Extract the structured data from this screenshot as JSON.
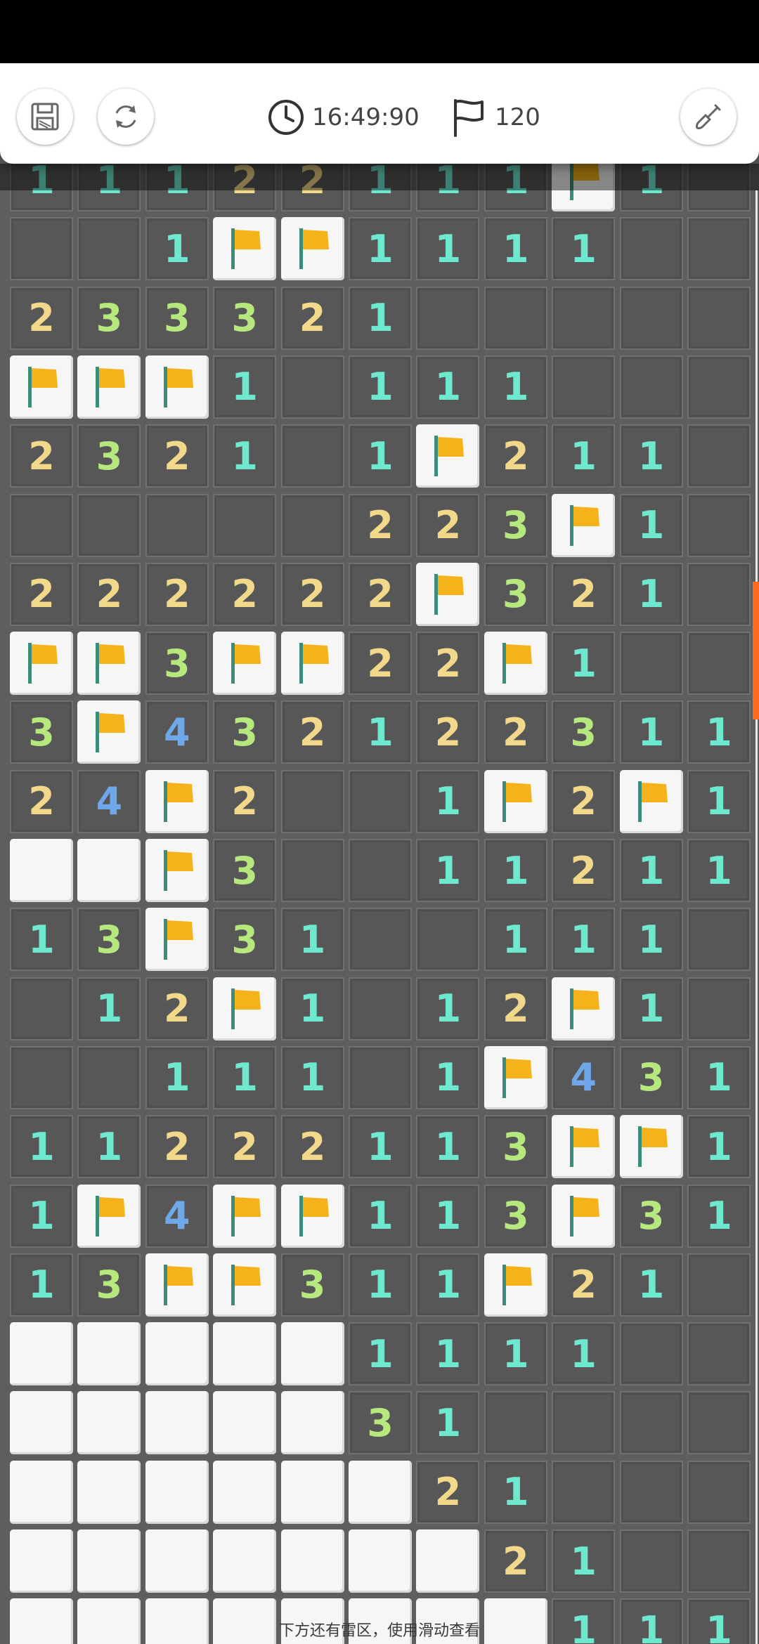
{
  "header": {
    "timer": "16:49:90",
    "flag_count": "120"
  },
  "board": {
    "columns": 11,
    "rows": [
      "11122111F1HH",
      "HH1FF1111HH",
      "233321HHHHH",
      "FFF1H111HHH",
      "2321H1F211H",
      "HHHHH223F1H",
      "222222F321H",
      "FF3FF22F1HH",
      "3F432122311",
      "24F2HH1F2F1",
      "RRF3HH11211",
      "13F31HH111H",
      "H12F1H12F1H",
      "HH111H1F431",
      "11222113FF1",
      "1F4FF113F31",
      "13FF311F21H",
      "RRRRR1111HH",
      "RRRRR31HHHH",
      "RRRRRR21HHH",
      "RRRRRRR21HH",
      "RRRRRRRR111"
    ],
    "legend": "H = hidden, R = revealed empty, F = flag, digit = adjacent mine count"
  },
  "colors": {
    "1": "#6fe8d0",
    "2": "#f2d88a",
    "3": "#b6e87e",
    "4": "#6ea8ea",
    "flag": "#f5b21b",
    "accent": "#ff6a1a"
  },
  "hint": "下方还有雷区，使用滑动查看"
}
